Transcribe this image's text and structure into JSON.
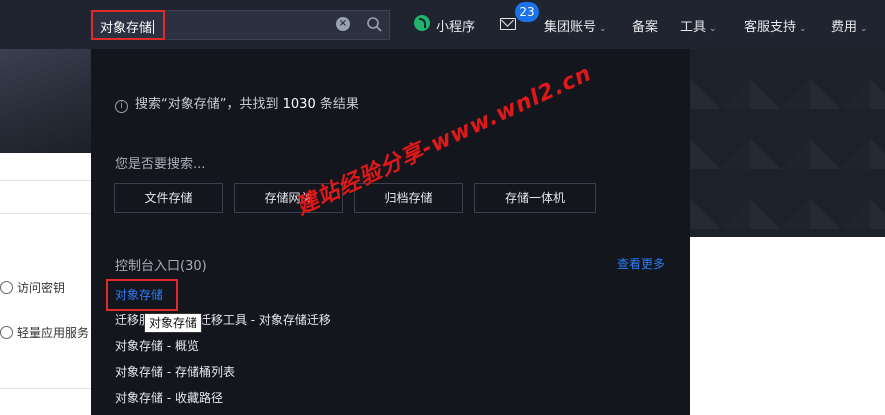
{
  "header": {
    "search_value": "对象存储",
    "nav": {
      "mini_program": "小程序",
      "mail_badge": "23",
      "group_account": "集团账号",
      "filing": "备案",
      "tools": "工具",
      "support": "客服支持",
      "billing": "费用"
    }
  },
  "sidebar": {
    "items": [
      "访问密钥",
      "轻量应用服务"
    ]
  },
  "dropdown": {
    "info_prefix": "搜索“对象存储”，共找到",
    "info_count": "1030",
    "info_suffix": "条结果",
    "suggest_label": "您是否要搜索...",
    "suggestions": [
      "文件存储",
      "存储网关",
      "归档存储",
      "存储一体机"
    ],
    "console_label": "控制台入口(30)",
    "view_more": "查看更多",
    "results": [
      "对象存储",
      "迁移服务平台 - 迁移工具 - 对象存储迁移",
      "对象存储 - 概览",
      "对象存储 - 存储桶列表",
      "对象存储 - 收藏路径"
    ],
    "tooltip": "对象存储"
  },
  "watermark": "建站经验分享-www.wnl2.cn"
}
